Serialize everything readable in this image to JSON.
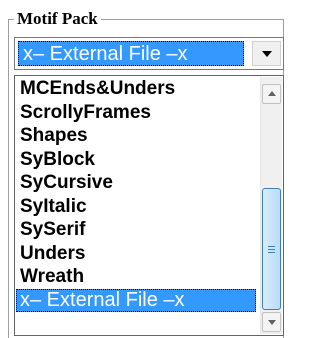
{
  "group": {
    "title": "Motif Pack"
  },
  "combo": {
    "value": "x– External File –x",
    "dropdown_icon": "chevron-down-icon"
  },
  "dropdown": {
    "items": [
      {
        "label": "MCEnds&Unders",
        "selected": false
      },
      {
        "label": "ScrollyFrames",
        "selected": false
      },
      {
        "label": "Shapes",
        "selected": false
      },
      {
        "label": "SyBlock",
        "selected": false
      },
      {
        "label": "SyCursive",
        "selected": false
      },
      {
        "label": "SyItalic",
        "selected": false
      },
      {
        "label": "SySerif",
        "selected": false
      },
      {
        "label": "Unders",
        "selected": false
      },
      {
        "label": "Wreath",
        "selected": false
      },
      {
        "label": "x– External File –x",
        "selected": true
      }
    ],
    "scrollbar": {
      "thumb_start": 0.4,
      "thumb_end": 1.0,
      "up_icon": "scroll-up-arrow-icon",
      "down_icon": "scroll-down-arrow-icon"
    }
  },
  "colors": {
    "selection": "#3399ff",
    "selection_text": "#ffffff",
    "scroll_thumb": "#b9dcf7"
  }
}
